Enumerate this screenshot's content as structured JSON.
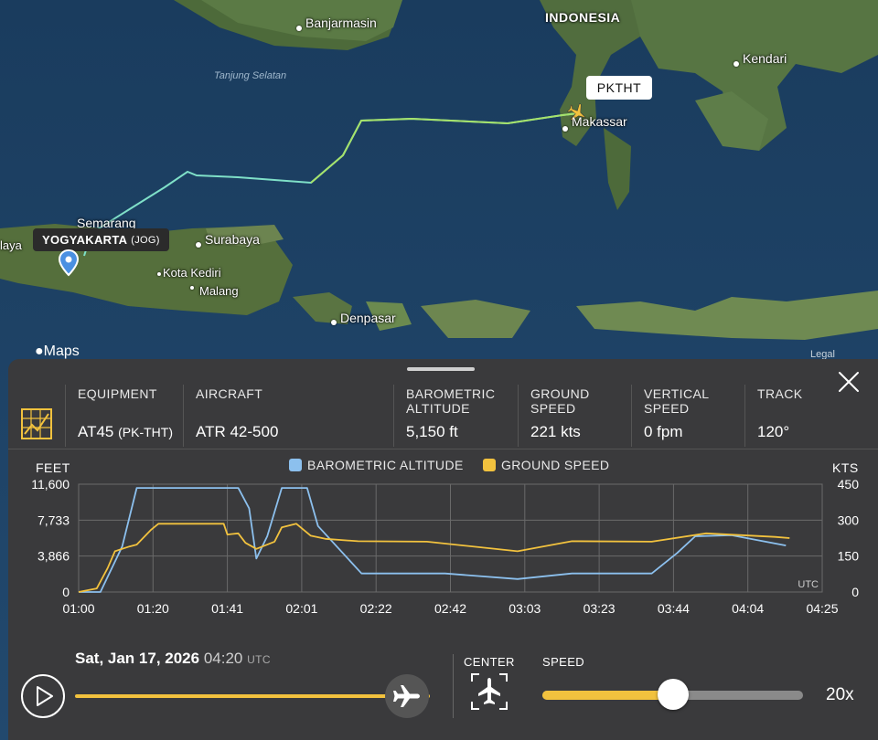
{
  "map": {
    "country_label": "INDONESIA",
    "sea_label": "Tanjung Selatan",
    "cities": [
      "Banjarmasin",
      "Kendari",
      "Makassar",
      "Semarang",
      "Surabaya",
      "Kota Kediri",
      "Malang",
      "Denpasar",
      "laya"
    ],
    "callsign": "PKTHT",
    "origin": {
      "name": "YOGYAKARTA",
      "code": "(JOG)"
    },
    "attribution": "Maps",
    "legal": "Legal"
  },
  "panel": {
    "stats": [
      {
        "label": "EQUIPMENT",
        "value": "AT45",
        "sub": "(PK-THT)"
      },
      {
        "label": "AIRCRAFT",
        "value": "ATR 42-500"
      },
      {
        "label": "BAROMETRIC\nALTITUDE",
        "value": "5,150 ft"
      },
      {
        "label": "GROUND\nSPEED",
        "value": "221 kts"
      },
      {
        "label": "VERTICAL\nSPEED",
        "value": "0 fpm"
      },
      {
        "label": "TRACK",
        "value": "120°"
      }
    ],
    "playback": {
      "date": "Sat, Jan 17, 2026",
      "time": "04:20",
      "tz": "UTC",
      "center_label": "CENTER",
      "speed_label": "SPEED",
      "speed_value": "20x",
      "speed_fraction": 0.5
    }
  },
  "colors": {
    "altitude": "#8cc0ee",
    "speed": "#f2c23e",
    "panel": "#3a3a3c"
  },
  "chart_data": {
    "type": "line",
    "left_axis_label": "FEET",
    "right_axis_label": "KTS",
    "utc_label": "UTC",
    "x_ticks": [
      "01:00",
      "01:20",
      "01:41",
      "02:01",
      "02:22",
      "02:42",
      "03:03",
      "03:23",
      "03:44",
      "04:04",
      "04:25"
    ],
    "y_left_ticks": [
      "11,600",
      "7,733",
      "3,866",
      "0"
    ],
    "y_right_ticks": [
      "450",
      "300",
      "150",
      "0"
    ],
    "ylim_left": [
      0,
      11600
    ],
    "ylim_right": [
      0,
      450
    ],
    "grid": true,
    "series": [
      {
        "name": "BAROMETRIC ALTITUDE",
        "axis": "left",
        "points": [
          [
            0,
            0
          ],
          [
            6,
            0
          ],
          [
            12,
            4900
          ],
          [
            16,
            11200
          ],
          [
            44,
            11200
          ],
          [
            47,
            9000
          ],
          [
            49,
            3600
          ],
          [
            52,
            6000
          ],
          [
            56,
            11200
          ],
          [
            63,
            11200
          ],
          [
            66,
            7100
          ],
          [
            78,
            2000
          ],
          [
            101,
            2000
          ],
          [
            121,
            1400
          ],
          [
            136,
            2000
          ],
          [
            158,
            2000
          ],
          [
            165,
            4200
          ],
          [
            170,
            6000
          ],
          [
            180,
            6100
          ],
          [
            195,
            5000
          ]
        ]
      },
      {
        "name": "GROUND SPEED",
        "axis": "right",
        "points": [
          [
            0,
            0
          ],
          [
            5,
            15
          ],
          [
            8,
            100
          ],
          [
            10,
            170
          ],
          [
            14,
            190
          ],
          [
            16,
            198
          ],
          [
            20,
            260
          ],
          [
            22,
            285
          ],
          [
            40,
            285
          ],
          [
            41,
            240
          ],
          [
            44,
            245
          ],
          [
            46,
            205
          ],
          [
            49,
            180
          ],
          [
            54,
            210
          ],
          [
            56,
            270
          ],
          [
            60,
            285
          ],
          [
            64,
            235
          ],
          [
            68,
            222
          ],
          [
            77,
            212
          ],
          [
            96,
            210
          ],
          [
            121,
            170
          ],
          [
            136,
            212
          ],
          [
            158,
            210
          ],
          [
            173,
            245
          ],
          [
            192,
            230
          ],
          [
            196,
            225
          ]
        ]
      }
    ]
  }
}
